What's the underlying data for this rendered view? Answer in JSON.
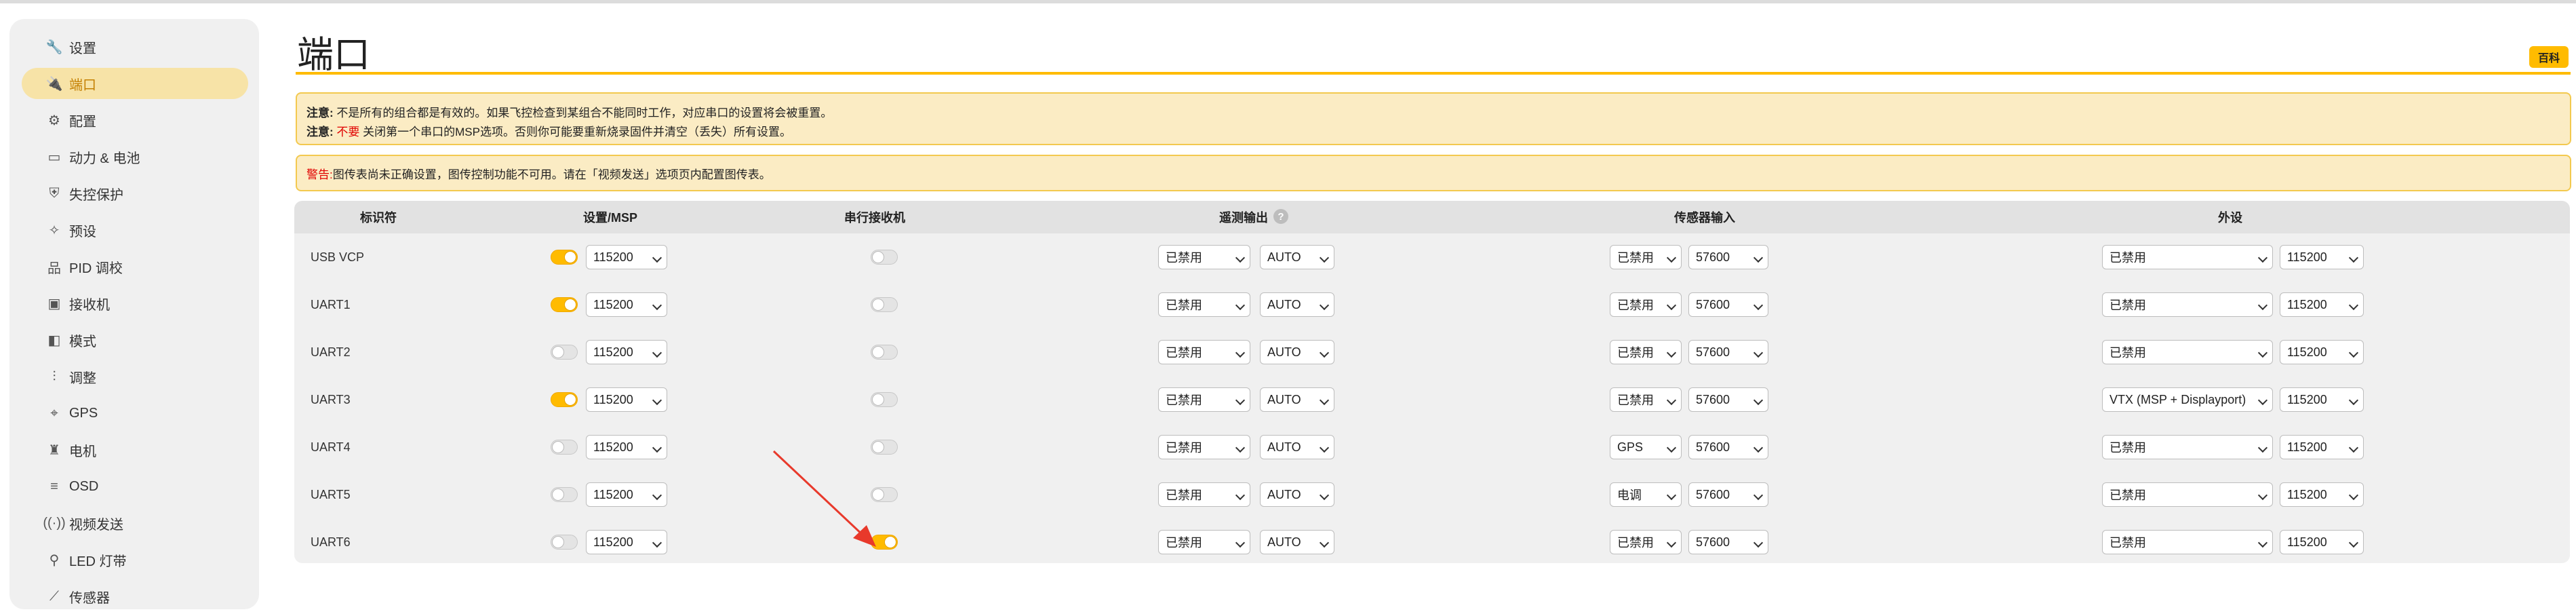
{
  "sidebar": {
    "items": [
      {
        "label": "设置",
        "icon": "wrench-icon",
        "glyph": "🔧",
        "active": false
      },
      {
        "label": "端口",
        "icon": "plug-icon",
        "glyph": "🔌",
        "active": true
      },
      {
        "label": "配置",
        "icon": "gear-icon",
        "glyph": "⚙",
        "active": false
      },
      {
        "label": "动力 & 电池",
        "icon": "battery-icon",
        "glyph": "▭",
        "active": false
      },
      {
        "label": "失控保护",
        "icon": "shield-icon",
        "glyph": "⛨",
        "active": false
      },
      {
        "label": "预设",
        "icon": "magic-wand-icon",
        "glyph": "✧",
        "active": false
      },
      {
        "label": "PID 调校",
        "icon": "sitemap-icon",
        "glyph": "品",
        "active": false
      },
      {
        "label": "接收机",
        "icon": "receiver-icon",
        "glyph": "▣",
        "active": false
      },
      {
        "label": "模式",
        "icon": "switch-icon",
        "glyph": "◧",
        "active": false
      },
      {
        "label": "调整",
        "icon": "sliders-icon",
        "glyph": "⫶",
        "active": false
      },
      {
        "label": "GPS",
        "icon": "location-icon",
        "glyph": "⌖",
        "active": false
      },
      {
        "label": "电机",
        "icon": "motor-icon",
        "glyph": "♜",
        "active": false
      },
      {
        "label": "OSD",
        "icon": "list-icon",
        "glyph": "≡",
        "active": false
      },
      {
        "label": "视频发送",
        "icon": "video-transmit-icon",
        "glyph": "((·))",
        "active": false
      },
      {
        "label": "LED 灯带",
        "icon": "led-icon",
        "glyph": "⚲",
        "active": false
      },
      {
        "label": "传感器",
        "icon": "sensor-chart-icon",
        "glyph": "⟋",
        "active": false
      }
    ]
  },
  "page": {
    "title": "端口",
    "wiki_label": "百科"
  },
  "notes": {
    "line1_bold": "注意:",
    "line1_text": "不是所有的组合都是有效的。如果飞控检查到某组合不能同时工作，对应串口的设置将会被重置。",
    "line2_bold": "注意:",
    "line2_red": "不要",
    "line2_text": "关闭第一个串口的MSP选项。否则你可能要重新烧录固件并清空（丢失）所有设置。"
  },
  "warning": {
    "prefix": "警告:",
    "text": "图传表尚未正确设置，图传控制功能不可用。请在「视频发送」选项页内配置图传表。"
  },
  "table": {
    "headers": {
      "identifier": "标识符",
      "config_msp": "设置/MSP",
      "serial_rx": "串行接收机",
      "telemetry": "遥测输出",
      "sensor": "传感器输入",
      "peripherals": "外设"
    },
    "rows": [
      {
        "id": "USB VCP",
        "msp_on": true,
        "msp_baud": "115200",
        "rx_on": false,
        "telem": "已禁用",
        "telem_baud": "AUTO",
        "sensor": "已禁用",
        "sensor_baud": "57600",
        "periph": "已禁用",
        "periph_baud": "115200"
      },
      {
        "id": "UART1",
        "msp_on": true,
        "msp_baud": "115200",
        "rx_on": false,
        "telem": "已禁用",
        "telem_baud": "AUTO",
        "sensor": "已禁用",
        "sensor_baud": "57600",
        "periph": "已禁用",
        "periph_baud": "115200"
      },
      {
        "id": "UART2",
        "msp_on": false,
        "msp_baud": "115200",
        "rx_on": false,
        "telem": "已禁用",
        "telem_baud": "AUTO",
        "sensor": "已禁用",
        "sensor_baud": "57600",
        "periph": "已禁用",
        "periph_baud": "115200"
      },
      {
        "id": "UART3",
        "msp_on": true,
        "msp_baud": "115200",
        "rx_on": false,
        "telem": "已禁用",
        "telem_baud": "AUTO",
        "sensor": "已禁用",
        "sensor_baud": "57600",
        "periph": "VTX (MSP + Displayport)",
        "periph_baud": "115200"
      },
      {
        "id": "UART4",
        "msp_on": false,
        "msp_baud": "115200",
        "rx_on": false,
        "telem": "已禁用",
        "telem_baud": "AUTO",
        "sensor": "GPS",
        "sensor_baud": "57600",
        "periph": "已禁用",
        "periph_baud": "115200"
      },
      {
        "id": "UART5",
        "msp_on": false,
        "msp_baud": "115200",
        "rx_on": false,
        "telem": "已禁用",
        "telem_baud": "AUTO",
        "sensor": "电调",
        "sensor_baud": "57600",
        "periph": "已禁用",
        "periph_baud": "115200"
      },
      {
        "id": "UART6",
        "msp_on": false,
        "msp_baud": "115200",
        "rx_on": true,
        "telem": "已禁用",
        "telem_baud": "AUTO",
        "sensor": "已禁用",
        "sensor_baud": "57600",
        "periph": "已禁用",
        "periph_baud": "115200"
      }
    ]
  },
  "colors": {
    "accent": "#ffbb00",
    "active_bg": "#f7e3a7",
    "annotation_arrow": "#e8392b",
    "warning_red": "#e00000"
  }
}
